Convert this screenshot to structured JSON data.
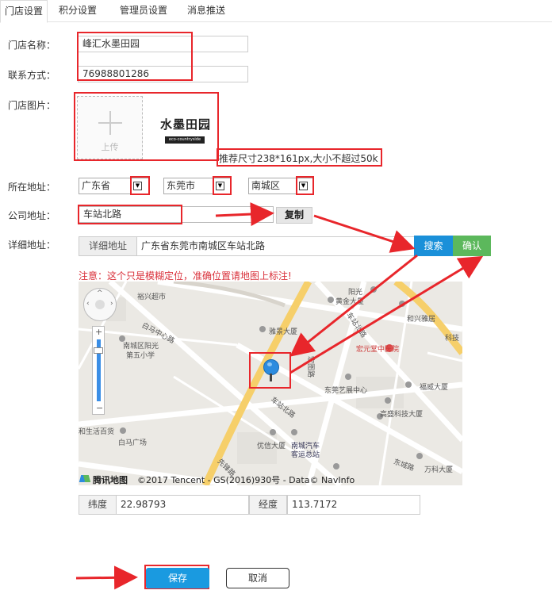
{
  "tabs": [
    "门店设置",
    "积分设置",
    "管理员设置",
    "消息推送"
  ],
  "form": {
    "store_name_label": "门店名称：",
    "store_name_value": "峰汇水墨田园",
    "contact_label": "联系方式：",
    "contact_value": "76988801286",
    "image_label": "门店图片：",
    "upload_text": "上传",
    "logo_text": "水墨田园",
    "logo_subtext": "eco-countryside",
    "image_hint": "推荐尺寸238*161px,大小不超过50k",
    "region_label": "所在地址：",
    "province": "广东省",
    "city": "东莞市",
    "district": "南城区",
    "company_label": "公司地址：",
    "company_value": "车站北路",
    "copy_label": "复制",
    "detail_label": "详细地址：",
    "detail_addon": "详细地址",
    "detail_value": "广东省东莞市南城区车站北路",
    "search_label": "搜索",
    "confirm_label": "确认",
    "note": "注意：这个只是模糊定位，准确位置请地图上标注!"
  },
  "map": {
    "labels": {
      "l1": "裕兴超市",
      "l2": "阳光",
      "l3": "黄金大厦",
      "l4": "和兴雅居",
      "l5": "白马中心路",
      "l6": "雅景大厦",
      "l7": "宏元堂中医院",
      "l8": "科技",
      "l9": "南城区阳光",
      "l10": "第五小学",
      "l11": "东莞艺展中心",
      "l12": "福威大厦",
      "l13": "高盛科技大厦",
      "l14": "和生活百货",
      "l15": "白马广场",
      "l16": "优信大厦",
      "l17": "南城汽车",
      "l18": "客运总站",
      "l19": "万科大厦",
      "l20": "车站北路",
      "l21": "车站北路",
      "l22": "先锋路",
      "l23": "宏图路",
      "l24": "东城路"
    },
    "brand": "腾讯地图",
    "copyright": "©2017 Tencent - GS(2016)930号 - Data© NavInfo"
  },
  "coords": {
    "lat_label": "纬度",
    "lat_value": "22.98793",
    "lng_label": "经度",
    "lng_value": "113.7172"
  },
  "actions": {
    "save_label": "保存",
    "cancel_label": "取消"
  },
  "colors": {
    "annotation_red": "#e8262b",
    "search_blue": "#1a90d9",
    "confirm_green": "#5cb85c",
    "save_blue": "#1a9ae0",
    "note_red": "#d9303a"
  }
}
